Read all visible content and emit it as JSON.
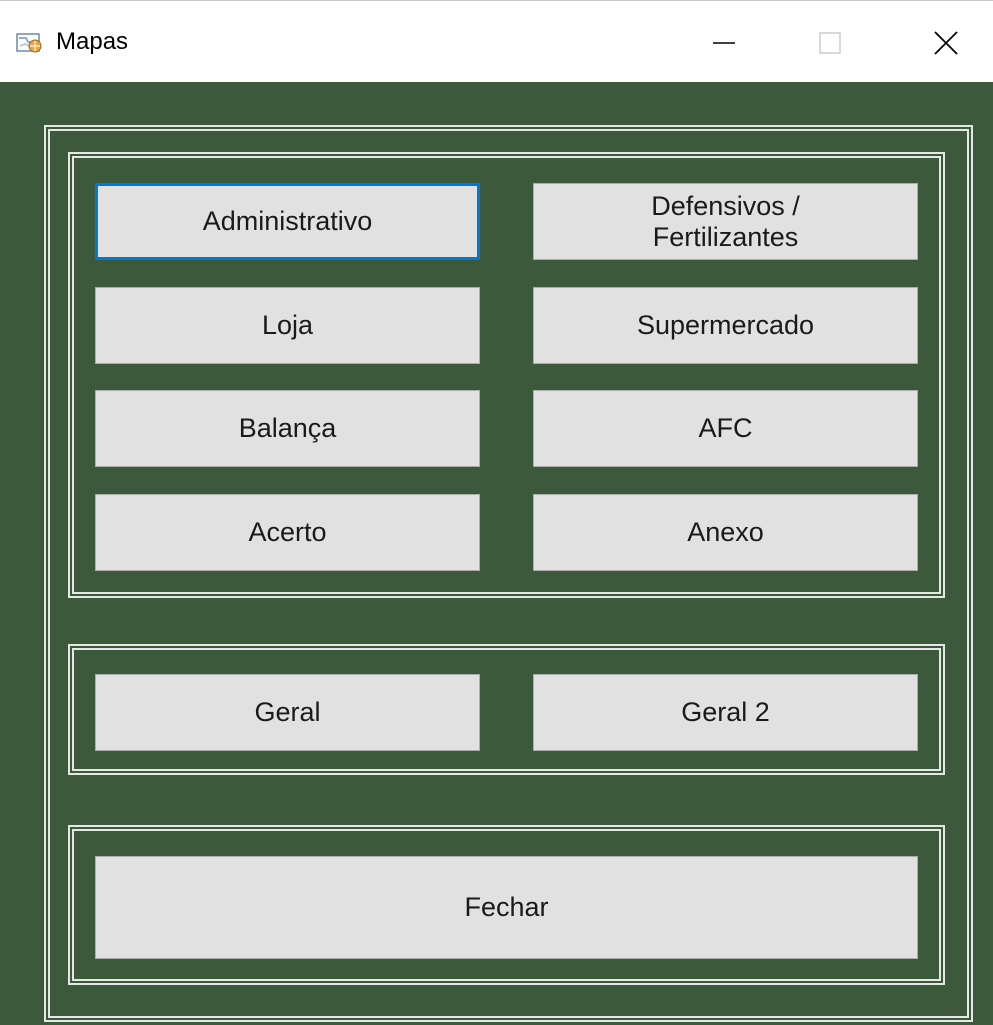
{
  "window": {
    "title": "Mapas",
    "icon": "map-app-icon",
    "controls": {
      "minimize": "minimize-icon",
      "maximize": "maximize-icon",
      "close": "close-icon"
    }
  },
  "colors": {
    "background": "#3c5a3b",
    "button": "#e1e1e1",
    "focus": "#0078d7",
    "frame": "#e3e8e3"
  },
  "groups": {
    "maps": {
      "buttons": [
        "Administrativo",
        "Defensivos /\nFertilizantes",
        "Loja",
        "Supermercado",
        "Balança",
        "AFC",
        "Acerto",
        "Anexo"
      ]
    },
    "general": {
      "buttons": [
        "Geral",
        "Geral 2"
      ]
    },
    "footer": {
      "close_label": "Fechar"
    }
  }
}
